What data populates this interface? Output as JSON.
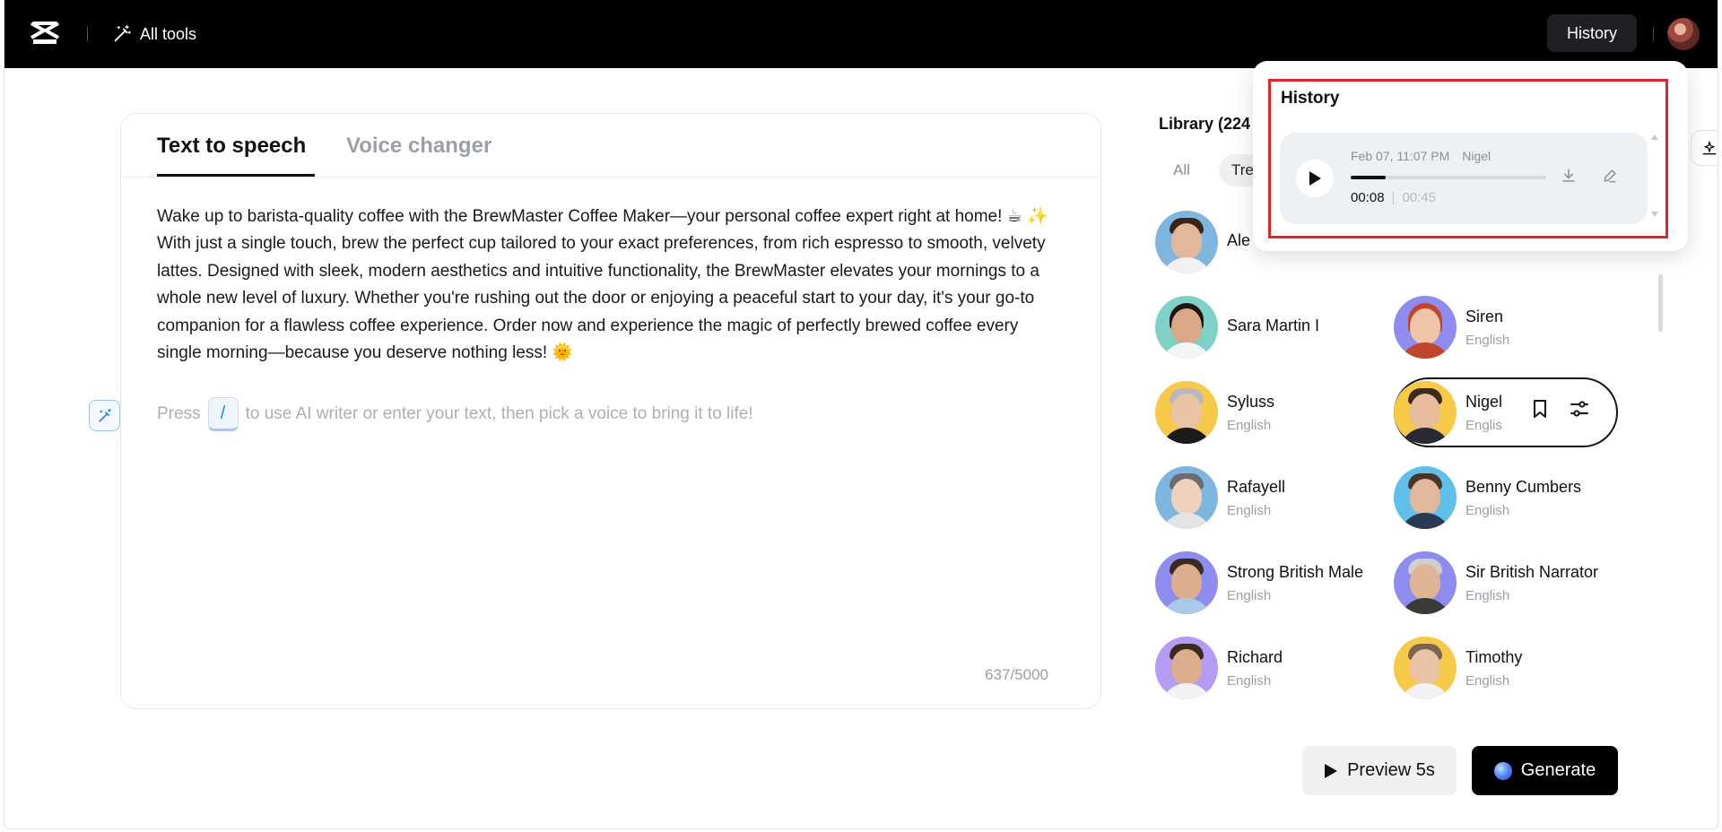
{
  "header": {
    "all_tools_label": "All tools",
    "history_label": "History"
  },
  "editor": {
    "tabs": [
      {
        "label": "Text to speech",
        "active": true
      },
      {
        "label": "Voice changer",
        "active": false
      }
    ],
    "text": "Wake up to barista-quality coffee with the BrewMaster Coffee Maker—your personal coffee expert right at home! ☕ ✨ With just a single touch, brew the perfect cup tailored to your exact preferences, from rich espresso to smooth, velvety lattes. Designed with sleek, modern aesthetics and intuitive functionality, the BrewMaster elevates your mornings to a whole new level of luxury. Whether you're rushing out the door or enjoying a peaceful start to your day, it's your go-to companion for a flawless coffee experience. Order now and experience the magic of perfectly brewed coffee every single morning—because you deserve nothing less! 🌞",
    "placeholder_prefix": "Press",
    "placeholder_key": "/",
    "placeholder_suffix": "to use AI writer or enter your text, then pick a voice to bring it to life!",
    "counter": "637/5000"
  },
  "library": {
    "title": "Library (224",
    "filters": [
      "All",
      "Tre"
    ],
    "voices": [
      {
        "name": "Ale",
        "lang": ""
      },
      {
        "name": "Sara Martin I",
        "lang": ""
      },
      {
        "name": "Siren",
        "lang": "English"
      },
      {
        "name": "Syluss",
        "lang": "English"
      },
      {
        "name": "Nigel",
        "lang": "Englis"
      },
      {
        "name": "Rafayell",
        "lang": "English"
      },
      {
        "name": "Benny Cumbers",
        "lang": "English"
      },
      {
        "name": "Strong British Male",
        "lang": "English"
      },
      {
        "name": "Sir British Narrator",
        "lang": "English"
      },
      {
        "name": "Richard",
        "lang": "English"
      },
      {
        "name": "Timothy",
        "lang": "English"
      }
    ],
    "selected_voice": "Nigel"
  },
  "actions": {
    "preview_label": "Preview 5s",
    "generate_label": "Generate"
  },
  "history_popover": {
    "title": "History",
    "item": {
      "date": "Feb 07, 11:07 PM",
      "voice": "Nigel",
      "current_time": "00:08",
      "total_time": "00:45",
      "progress_fraction": 0.178
    }
  },
  "colors": {
    "accent_blue": "#2b7de9",
    "highlight_red": "#e0242b",
    "topbar": "#000000"
  },
  "icons": [
    "capcut-logo-icon",
    "magic-wand-icon",
    "play-icon",
    "download-icon",
    "edit-icon",
    "bookmark-icon",
    "sliders-icon",
    "sparkle-icon"
  ]
}
